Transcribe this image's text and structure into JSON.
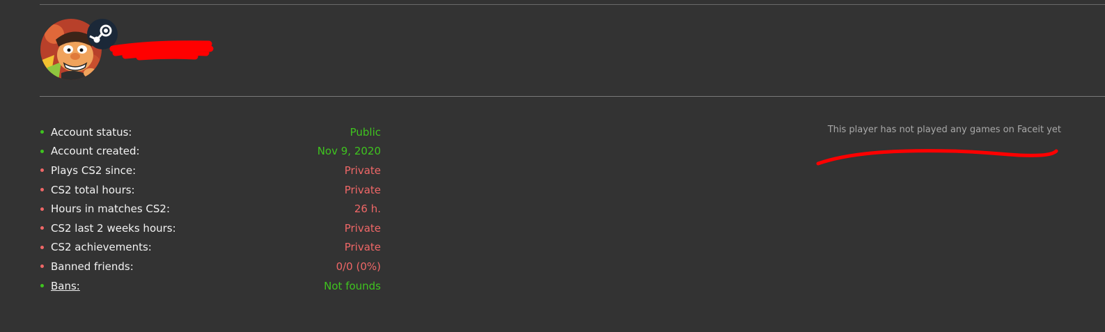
{
  "profile": {
    "avatar_icon": "avatar-cartoon-character",
    "platform_icon": "steam-icon",
    "username_redacted": true
  },
  "colors": {
    "good": "#3fc41f",
    "bad": "#ef6767",
    "label": "#f2f2f2",
    "muted": "#a9a9a9",
    "background": "#333333"
  },
  "stats": [
    {
      "label": "Account status:",
      "value": "Public",
      "status": "good"
    },
    {
      "label": "Account created:",
      "value": "Nov 9, 2020",
      "status": "good"
    },
    {
      "label": "Plays CS2 since:",
      "value": "Private",
      "status": "bad"
    },
    {
      "label": "CS2 total hours:",
      "value": "Private",
      "status": "bad"
    },
    {
      "label": "Hours in matches CS2:",
      "value": "26 h.",
      "status": "bad"
    },
    {
      "label": "CS2 last 2 weeks hours:",
      "value": "Private",
      "status": "bad"
    },
    {
      "label": "CS2 achievements:",
      "value": "Private",
      "status": "bad"
    },
    {
      "label": "Banned friends:",
      "value": "0/0 (0%)",
      "status": "bad"
    },
    {
      "label": "Bans:",
      "value": "Not founds",
      "status": "good",
      "link": true
    }
  ],
  "faceit": {
    "message": "This player has not played any games on Faceit yet"
  }
}
